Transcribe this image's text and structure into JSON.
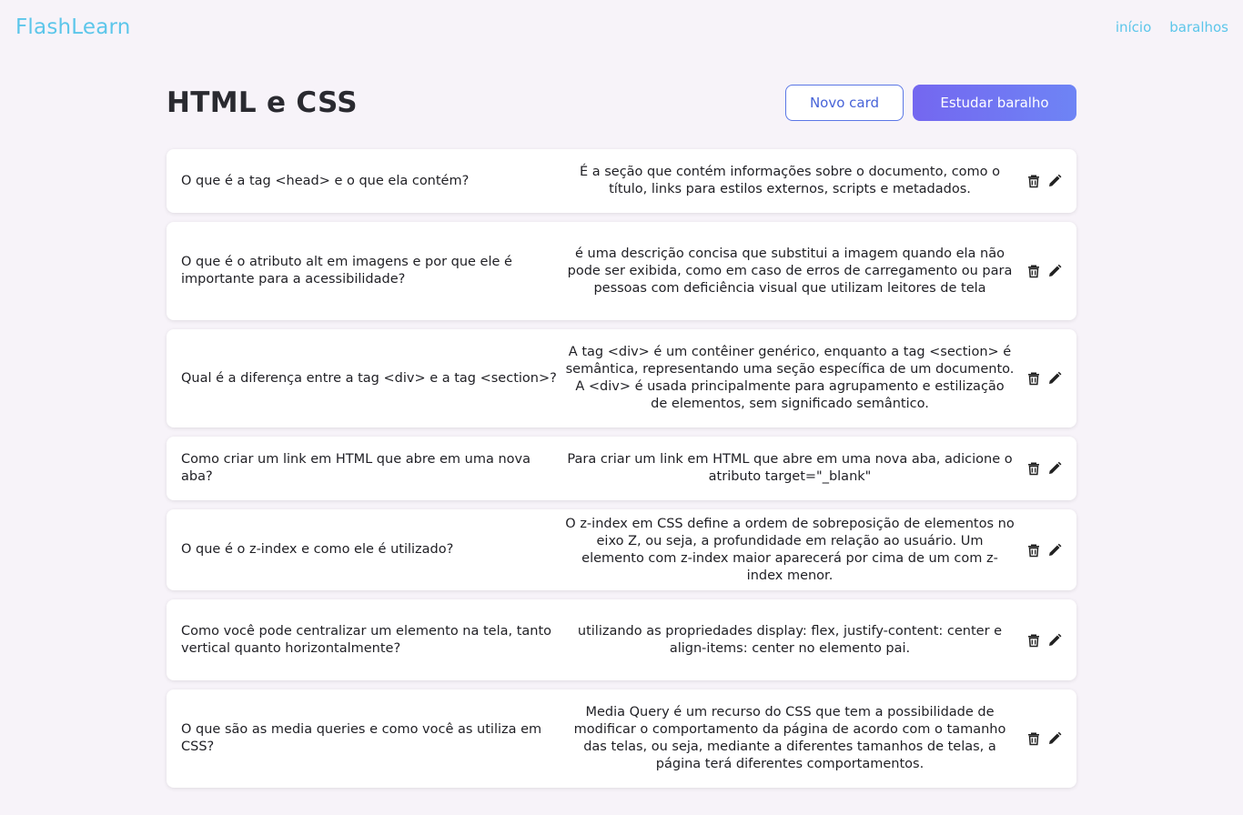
{
  "app": {
    "logo": "FlashLearn",
    "nav": [
      "início",
      "baralhos"
    ]
  },
  "deck": {
    "title": "HTML e CSS",
    "new_card_label": "Novo card",
    "study_label": "Estudar baralho"
  },
  "cards": [
    {
      "question": "O que é a tag <head> e o que ela contém?",
      "answer": "É a seção que contém informações sobre o documento, como o título, links para estilos externos, scripts e metadados."
    },
    {
      "question": "O que é o atributo alt em imagens e por que ele é importante para a acessibilidade?",
      "answer": "é uma descrição concisa que substitui a imagem quando ela não pode ser exibida, como em caso de erros de carregamento ou para pessoas com deficiência visual que utilizam leitores de tela"
    },
    {
      "question": "Qual é a diferença entre a tag <div> e a tag <section>?",
      "answer": "A tag <div> é um contêiner genérico, enquanto a tag <section> é semântica, representando uma seção específica de um documento. A <div> é usada principalmente para agrupamento e estilização de elementos, sem significado semântico."
    },
    {
      "question": "Como criar um link em HTML que abre em uma nova aba?",
      "answer": "Para criar um link em HTML que abre em uma nova aba, adicione o atributo target=\"_blank\""
    },
    {
      "question": "O que é o z-index e como ele é utilizado?",
      "answer": "O z-index em CSS define a ordem de sobreposição de elementos no eixo Z, ou seja, a profundidade em relação ao usuário. Um elemento com z-index maior aparecerá por cima de um com z-index menor."
    },
    {
      "question": "Como você pode centralizar um elemento na tela, tanto vertical quanto horizontalmente?",
      "answer": "utilizando as propriedades display: flex, justify-content: center e align-items: center no elemento pai."
    },
    {
      "question": "O que são as media queries e como você as utiliza em CSS?",
      "answer": "Media Query é um recurso do CSS que tem a possibilidade de modificar o comportamento da página de acordo com o tamanho das telas, ou seja, mediante a diferentes tamanhos de telas, a página terá diferentes comportamentos."
    }
  ],
  "icons": {
    "delete": "trash-icon",
    "edit": "pencil-icon"
  },
  "colors": {
    "background": "#f7f3f9",
    "brand": "#5cc6ea",
    "primary_start": "#7467f0",
    "primary_end": "#6e84f5",
    "outline": "#5b77e6"
  }
}
